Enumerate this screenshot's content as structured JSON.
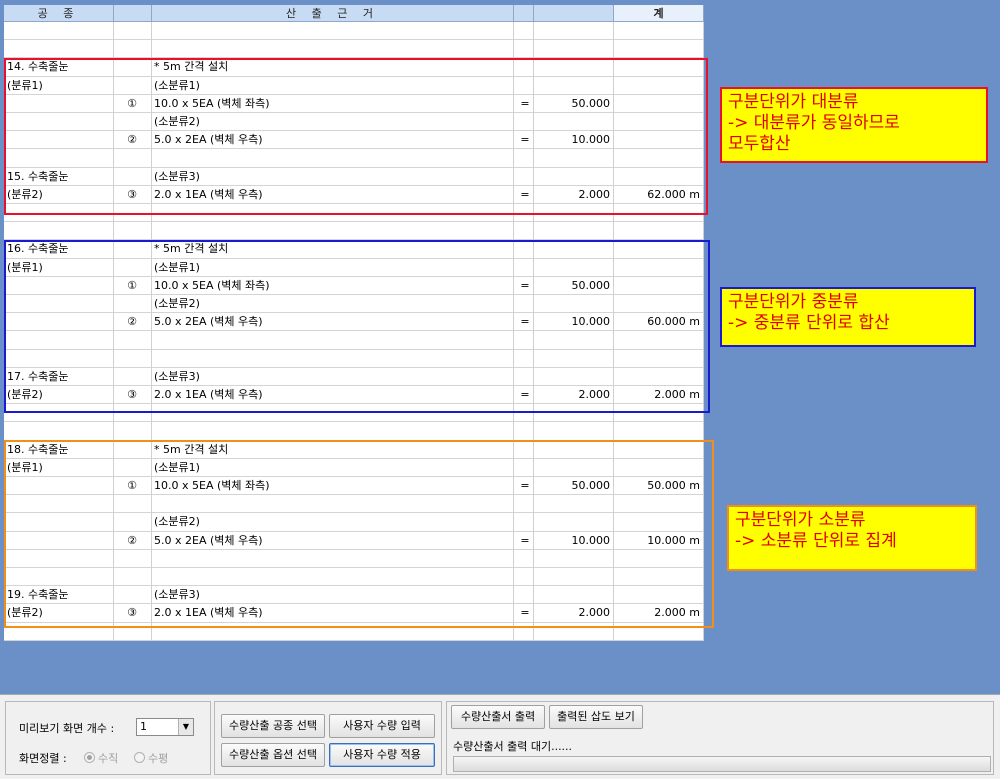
{
  "sheet": {
    "headers": [
      "공 종",
      "",
      "산 출 근 거",
      "",
      "",
      "계"
    ],
    "rows": [
      [
        "",
        "",
        "",
        "",
        "",
        ""
      ],
      [
        "",
        "",
        "",
        "",
        "",
        ""
      ],
      [
        "14. 수축줄눈",
        "",
        "* 5m 간격 설치",
        "",
        "",
        ""
      ],
      [
        "(분류1)",
        "",
        "(소분류1)",
        "",
        "",
        ""
      ],
      [
        "",
        "①",
        "10.0 x 5EA (벽체 좌측)",
        "=",
        "50.000",
        ""
      ],
      [
        "",
        "",
        "(소분류2)",
        "",
        "",
        ""
      ],
      [
        "",
        "②",
        "5.0 x 2EA (벽체 우측)",
        "=",
        "10.000",
        ""
      ],
      [
        "",
        "",
        "",
        "",
        "",
        ""
      ],
      [
        "15. 수축줄눈",
        "",
        "(소분류3)",
        "",
        "",
        ""
      ],
      [
        "(분류2)",
        "③",
        "2.0 x 1EA (벽체 우측)",
        "=",
        "2.000",
        "62.000 m"
      ],
      [
        "",
        "",
        "",
        "",
        "",
        ""
      ],
      [
        "",
        "",
        "",
        "",
        "",
        ""
      ],
      [
        "16. 수축줄눈",
        "",
        "* 5m 간격 설치",
        "",
        "",
        ""
      ],
      [
        "(분류1)",
        "",
        "(소분류1)",
        "",
        "",
        ""
      ],
      [
        "",
        "①",
        "10.0 x 5EA (벽체 좌측)",
        "=",
        "50.000",
        ""
      ],
      [
        "",
        "",
        "(소분류2)",
        "",
        "",
        ""
      ],
      [
        "",
        "②",
        "5.0 x 2EA (벽체 우측)",
        "=",
        "10.000",
        "60.000 m"
      ],
      [
        "",
        "",
        "",
        "",
        "",
        ""
      ],
      [
        "",
        "",
        "",
        "",
        "",
        ""
      ],
      [
        "17. 수축줄눈",
        "",
        "(소분류3)",
        "",
        "",
        ""
      ],
      [
        "(분류2)",
        "③",
        "2.0 x 1EA (벽체 우측)",
        "=",
        "2.000",
        "2.000 m"
      ],
      [
        "",
        "",
        "",
        "",
        "",
        ""
      ],
      [
        "",
        "",
        "",
        "",
        "",
        ""
      ],
      [
        "18. 수축줄눈",
        "",
        "* 5m 간격 설치",
        "",
        "",
        ""
      ],
      [
        "(분류1)",
        "",
        "(소분류1)",
        "",
        "",
        ""
      ],
      [
        "",
        "①",
        "10.0 x 5EA (벽체 좌측)",
        "=",
        "50.000",
        "50.000 m"
      ],
      [
        "",
        "",
        "",
        "",
        "",
        ""
      ],
      [
        "",
        "",
        "(소분류2)",
        "",
        "",
        ""
      ],
      [
        "",
        "②",
        "5.0 x 2EA (벽체 우측)",
        "=",
        "10.000",
        "10.000 m"
      ],
      [
        "",
        "",
        "",
        "",
        "",
        ""
      ],
      [
        "",
        "",
        "",
        "",
        "",
        ""
      ],
      [
        "19. 수축줄눈",
        "",
        "(소분류3)",
        "",
        "",
        ""
      ],
      [
        "(분류2)",
        "③",
        "2.0 x 1EA (벽체 우측)",
        "=",
        "2.000",
        "2.000 m"
      ],
      [
        "",
        "",
        "",
        "",
        "",
        ""
      ]
    ]
  },
  "annotations": {
    "red_note": "구분단위가 대분류\n-> 대분류가 동일하므로\n모두합산",
    "blue_note": "구분단위가 중분류\n-> 중분류 단위로 합산",
    "orange_note": "구분단위가 소분류\n-> 소분류 단위로 집계",
    "colors": {
      "red": "#e8102a",
      "blue": "#1a1ad0",
      "orange": "#f0901a",
      "note_bg": "#ffff00",
      "note_text": "#e00000"
    }
  },
  "controls": {
    "preview_count_label": "미리보기 화면 개수 :",
    "preview_count_value": "1",
    "sort_label": "화면정렬 :",
    "vertical_label": "수직",
    "horizontal_label": "수평",
    "btn_select_work": "수량산출 공종 선택",
    "btn_select_option": "수량산출 옵션 선택",
    "btn_user_input": "사용자 수량 입력",
    "btn_user_apply": "사용자 수량 적용",
    "btn_print": "수량산출서 출력",
    "btn_view_printed": "출력된 삽도 보기",
    "print_status": "수량산출서 출력 대기......",
    "progress_fraction": 0
  }
}
